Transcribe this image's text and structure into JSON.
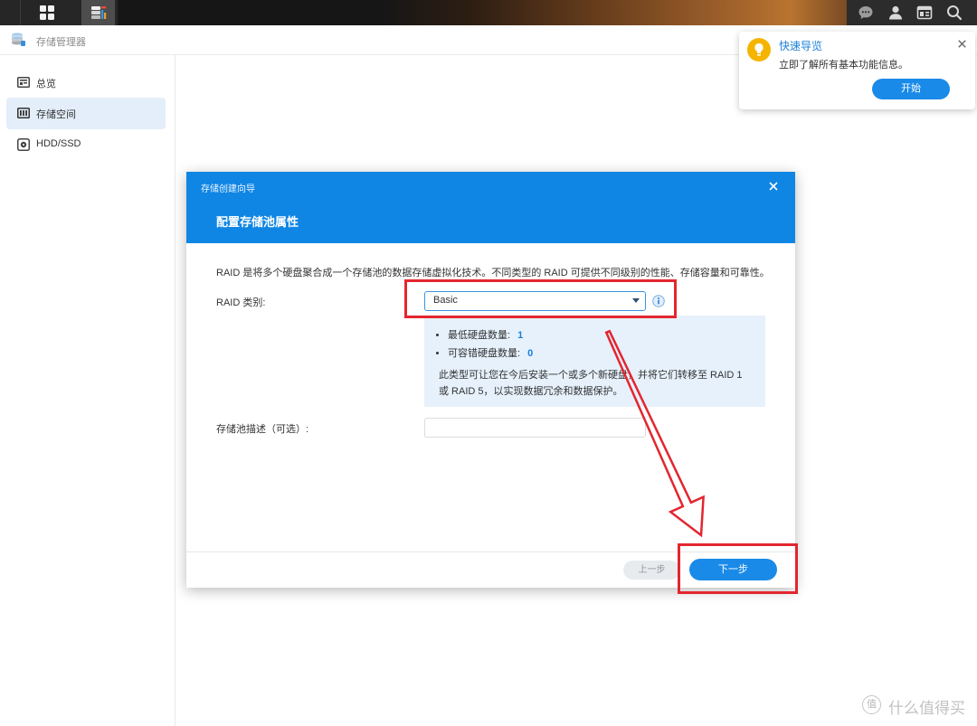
{
  "taskbar": {
    "icons": [
      "apps-grid-icon",
      "storage-manager-icon",
      "chat-icon",
      "user-icon",
      "widgets-icon",
      "search-icon"
    ]
  },
  "window": {
    "title": "存储管理器",
    "icon": "storage-manager-icon"
  },
  "sidebar": {
    "items": [
      {
        "label": "总览",
        "icon": "overview-icon",
        "active": false
      },
      {
        "label": "存储空间",
        "icon": "storage-pool-icon",
        "active": true
      },
      {
        "label": "HDD/SSD",
        "icon": "disk-icon",
        "active": false
      }
    ]
  },
  "quick_tour": {
    "icon": "lightbulb-icon",
    "title": "快速导览",
    "message": "立即了解所有基本功能信息。",
    "start_label": "开始"
  },
  "wizard": {
    "window_title": "存储创建向导",
    "step_title": "配置存储池属性",
    "intro": "RAID 是将多个硬盘聚合成一个存储池的数据存储虚拟化技术。不同类型的 RAID 可提供不同级别的性能、存储容量和可靠性。",
    "raid_type": {
      "label": "RAID 类别:",
      "value": "Basic"
    },
    "raid_info": {
      "min_disks": {
        "label": "最低硬盘数量:",
        "value": "1"
      },
      "fault_tolerance": {
        "label": "可容错硬盘数量:",
        "value": "0"
      },
      "description": "此类型可让您在今后安装一个或多个新硬盘，并将它们转移至 RAID 1 或 RAID 5，以实现数据冗余和数据保护。"
    },
    "pool_description": {
      "label": "存储池描述（可选）:",
      "value": ""
    },
    "buttons": {
      "back": "上一步",
      "next": "下一步"
    }
  },
  "watermark": {
    "badge": "值",
    "text": "什么值得买"
  },
  "colors": {
    "accent": "#0f86e4",
    "button_primary": "#1a8ae8",
    "info_panel": "#e6f1fc",
    "sidebar_active": "#e3eefa",
    "tour_icon": "#f5b400",
    "annotation": "#e3262f",
    "taskbar": "#161616"
  }
}
